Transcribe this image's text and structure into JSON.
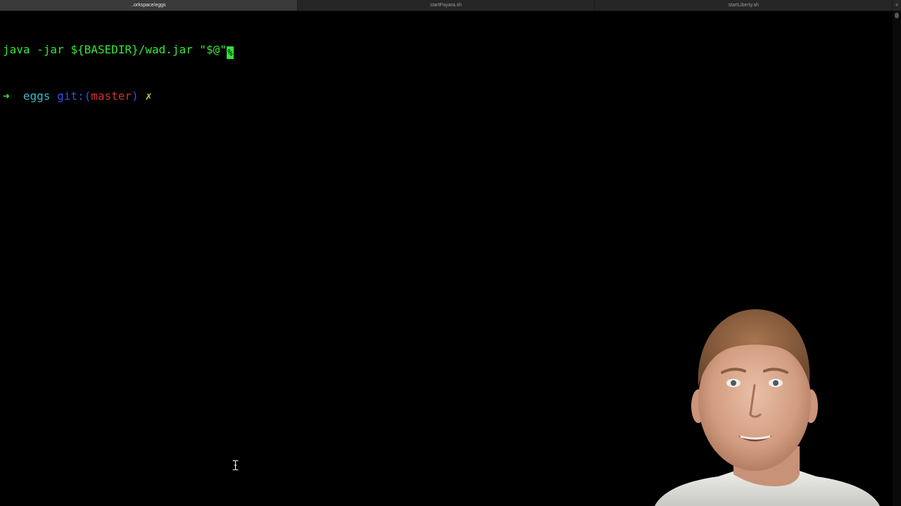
{
  "tabs": [
    {
      "label": "..orkspace/eggs",
      "active": true
    },
    {
      "label": "startPayara.sh",
      "active": false
    },
    {
      "label": "startLiberty.sh",
      "active": false
    }
  ],
  "tab_add_label": "+",
  "terminal": {
    "line1": {
      "command": "java -jar ${BASEDIR}/wad.jar \"$@\"",
      "cursor_glyph": "%"
    },
    "line2": {
      "arrow": "➜",
      "dir": "eggs",
      "git_prefix": "git:(",
      "branch": "master",
      "git_suffix": ")",
      "dirty": "✗"
    }
  },
  "colors": {
    "terminal_background": "#000000",
    "prompt_green": "#35e635",
    "dir_cyan": "#3fb9c9",
    "git_blue": "#3050e8",
    "branch_red": "#d03030",
    "dirty_yellow": "#c8c83a"
  },
  "icons": {
    "mouse_cursor": "i-beam-cursor-icon",
    "scroll": "scrollbar"
  },
  "overlay": {
    "type": "presenter-webcam"
  }
}
